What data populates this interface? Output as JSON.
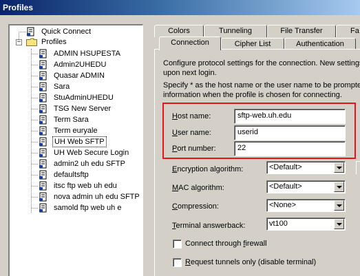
{
  "window": {
    "title": "Profiles"
  },
  "tree": {
    "root_items": [
      {
        "label": "Quick Connect",
        "icon": "document-icon"
      },
      {
        "label": "Profiles",
        "icon": "folder-icon"
      }
    ],
    "profiles": [
      "ADMIN HSUPESTA",
      "Admin2UHEDU",
      "Quasar ADMIN",
      "Sara",
      "StuAdminUHEDU",
      "TSG New Server",
      "Term Sara",
      "Term euryale",
      "UH Web SFTP",
      "UH Web Secure Login",
      "admin2 uh edu SFTP",
      "defaultsftp",
      "itsc ftp web uh edu",
      "nova admin uh edu SFTP",
      "samold ftp web uh e"
    ],
    "selected": "UH Web SFTP"
  },
  "tabs": {
    "row1": [
      "Colors",
      "Tunneling",
      "File Transfer",
      "Fa"
    ],
    "row2": [
      "Connection",
      "Cipher List",
      "Authentication"
    ],
    "active": "Connection"
  },
  "connection": {
    "description": [
      "Configure protocol settings for the connection. New settings t",
      "upon next login."
    ],
    "specify_note": [
      "Specify * as the host name or the user name to be prompted",
      "information when the profile is chosen for connecting."
    ],
    "host_label": {
      "key": "H",
      "rest": "ost name:"
    },
    "host_value": "sftp-web.uh.edu",
    "user_label": {
      "key": "U",
      "rest": "ser name:"
    },
    "user_value": "userid",
    "port_label": {
      "key": "P",
      "rest": "ort number:"
    },
    "port_value": "22",
    "encryption_label": {
      "key": "E",
      "rest": "ncryption algorithm:"
    },
    "encryption_value": "<Default>",
    "mac_label": {
      "key": "M",
      "rest": "AC algorithm:"
    },
    "mac_value": "<Default>",
    "compression_label": {
      "key": "C",
      "rest": "ompression:"
    },
    "compression_value": "<None>",
    "terminal_label": {
      "key": "T",
      "rest": "erminal answerback:"
    },
    "terminal_value": "vt100",
    "firewall_label": {
      "pre": "Connect through ",
      "key": "f",
      "rest": "irewall"
    },
    "firewall_checked": false,
    "tunnels_label": {
      "key": "R",
      "rest": "equest tunnels only (disable terminal)"
    },
    "tunnels_checked": false
  },
  "colors": {
    "highlight_box": "#e8141c",
    "titlebar": "#0a246a"
  }
}
